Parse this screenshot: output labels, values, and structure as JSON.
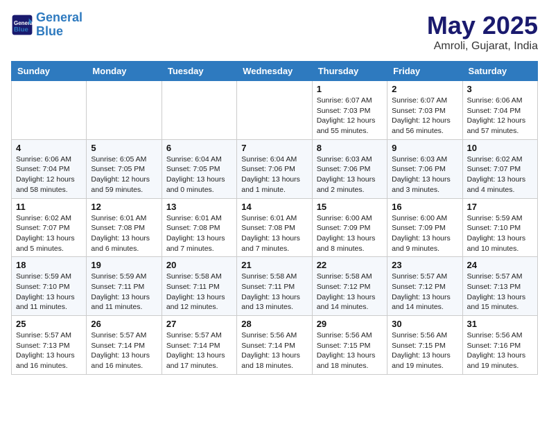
{
  "header": {
    "logo_line1": "General",
    "logo_line2": "Blue",
    "month": "May 2025",
    "location": "Amroli, Gujarat, India"
  },
  "days_of_week": [
    "Sunday",
    "Monday",
    "Tuesday",
    "Wednesday",
    "Thursday",
    "Friday",
    "Saturday"
  ],
  "weeks": [
    [
      {
        "day": "",
        "info": ""
      },
      {
        "day": "",
        "info": ""
      },
      {
        "day": "",
        "info": ""
      },
      {
        "day": "",
        "info": ""
      },
      {
        "day": "1",
        "info": "Sunrise: 6:07 AM\nSunset: 7:03 PM\nDaylight: 12 hours\nand 55 minutes."
      },
      {
        "day": "2",
        "info": "Sunrise: 6:07 AM\nSunset: 7:03 PM\nDaylight: 12 hours\nand 56 minutes."
      },
      {
        "day": "3",
        "info": "Sunrise: 6:06 AM\nSunset: 7:04 PM\nDaylight: 12 hours\nand 57 minutes."
      }
    ],
    [
      {
        "day": "4",
        "info": "Sunrise: 6:06 AM\nSunset: 7:04 PM\nDaylight: 12 hours\nand 58 minutes."
      },
      {
        "day": "5",
        "info": "Sunrise: 6:05 AM\nSunset: 7:05 PM\nDaylight: 12 hours\nand 59 minutes."
      },
      {
        "day": "6",
        "info": "Sunrise: 6:04 AM\nSunset: 7:05 PM\nDaylight: 13 hours\nand 0 minutes."
      },
      {
        "day": "7",
        "info": "Sunrise: 6:04 AM\nSunset: 7:06 PM\nDaylight: 13 hours\nand 1 minute."
      },
      {
        "day": "8",
        "info": "Sunrise: 6:03 AM\nSunset: 7:06 PM\nDaylight: 13 hours\nand 2 minutes."
      },
      {
        "day": "9",
        "info": "Sunrise: 6:03 AM\nSunset: 7:06 PM\nDaylight: 13 hours\nand 3 minutes."
      },
      {
        "day": "10",
        "info": "Sunrise: 6:02 AM\nSunset: 7:07 PM\nDaylight: 13 hours\nand 4 minutes."
      }
    ],
    [
      {
        "day": "11",
        "info": "Sunrise: 6:02 AM\nSunset: 7:07 PM\nDaylight: 13 hours\nand 5 minutes."
      },
      {
        "day": "12",
        "info": "Sunrise: 6:01 AM\nSunset: 7:08 PM\nDaylight: 13 hours\nand 6 minutes."
      },
      {
        "day": "13",
        "info": "Sunrise: 6:01 AM\nSunset: 7:08 PM\nDaylight: 13 hours\nand 7 minutes."
      },
      {
        "day": "14",
        "info": "Sunrise: 6:01 AM\nSunset: 7:08 PM\nDaylight: 13 hours\nand 7 minutes."
      },
      {
        "day": "15",
        "info": "Sunrise: 6:00 AM\nSunset: 7:09 PM\nDaylight: 13 hours\nand 8 minutes."
      },
      {
        "day": "16",
        "info": "Sunrise: 6:00 AM\nSunset: 7:09 PM\nDaylight: 13 hours\nand 9 minutes."
      },
      {
        "day": "17",
        "info": "Sunrise: 5:59 AM\nSunset: 7:10 PM\nDaylight: 13 hours\nand 10 minutes."
      }
    ],
    [
      {
        "day": "18",
        "info": "Sunrise: 5:59 AM\nSunset: 7:10 PM\nDaylight: 13 hours\nand 11 minutes."
      },
      {
        "day": "19",
        "info": "Sunrise: 5:59 AM\nSunset: 7:11 PM\nDaylight: 13 hours\nand 11 minutes."
      },
      {
        "day": "20",
        "info": "Sunrise: 5:58 AM\nSunset: 7:11 PM\nDaylight: 13 hours\nand 12 minutes."
      },
      {
        "day": "21",
        "info": "Sunrise: 5:58 AM\nSunset: 7:11 PM\nDaylight: 13 hours\nand 13 minutes."
      },
      {
        "day": "22",
        "info": "Sunrise: 5:58 AM\nSunset: 7:12 PM\nDaylight: 13 hours\nand 14 minutes."
      },
      {
        "day": "23",
        "info": "Sunrise: 5:57 AM\nSunset: 7:12 PM\nDaylight: 13 hours\nand 14 minutes."
      },
      {
        "day": "24",
        "info": "Sunrise: 5:57 AM\nSunset: 7:13 PM\nDaylight: 13 hours\nand 15 minutes."
      }
    ],
    [
      {
        "day": "25",
        "info": "Sunrise: 5:57 AM\nSunset: 7:13 PM\nDaylight: 13 hours\nand 16 minutes."
      },
      {
        "day": "26",
        "info": "Sunrise: 5:57 AM\nSunset: 7:14 PM\nDaylight: 13 hours\nand 16 minutes."
      },
      {
        "day": "27",
        "info": "Sunrise: 5:57 AM\nSunset: 7:14 PM\nDaylight: 13 hours\nand 17 minutes."
      },
      {
        "day": "28",
        "info": "Sunrise: 5:56 AM\nSunset: 7:14 PM\nDaylight: 13 hours\nand 18 minutes."
      },
      {
        "day": "29",
        "info": "Sunrise: 5:56 AM\nSunset: 7:15 PM\nDaylight: 13 hours\nand 18 minutes."
      },
      {
        "day": "30",
        "info": "Sunrise: 5:56 AM\nSunset: 7:15 PM\nDaylight: 13 hours\nand 19 minutes."
      },
      {
        "day": "31",
        "info": "Sunrise: 5:56 AM\nSunset: 7:16 PM\nDaylight: 13 hours\nand 19 minutes."
      }
    ]
  ]
}
